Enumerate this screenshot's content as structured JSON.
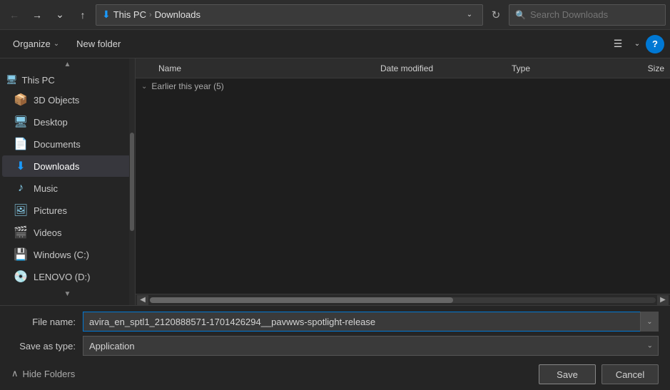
{
  "titlebar": {
    "back_label": "←",
    "forward_label": "→",
    "recent_label": "⌄",
    "up_label": "↑",
    "path_icon": "⬇",
    "breadcrumb": [
      "This PC",
      "Downloads"
    ],
    "breadcrumb_sep": "›",
    "dropdown_arrow": "⌄",
    "refresh_label": "↻",
    "search_placeholder": "Search Downloads"
  },
  "toolbar": {
    "organize_label": "Organize",
    "new_folder_label": "New folder",
    "view_icon": "☰",
    "view_dropdown": "⌄",
    "help_label": "?"
  },
  "sidebar": {
    "scroll_up": "▲",
    "scroll_down": "▼",
    "this_pc_label": "This PC",
    "items": [
      {
        "id": "3d-objects",
        "label": "3D Objects",
        "icon": "📦"
      },
      {
        "id": "desktop",
        "label": "Desktop",
        "icon": "🖥"
      },
      {
        "id": "documents",
        "label": "Documents",
        "icon": "📄"
      },
      {
        "id": "downloads",
        "label": "Downloads",
        "icon": "⬇",
        "active": true
      },
      {
        "id": "music",
        "label": "Music",
        "icon": "♪"
      },
      {
        "id": "pictures",
        "label": "Pictures",
        "icon": "🖼"
      },
      {
        "id": "videos",
        "label": "Videos",
        "icon": "🎬"
      },
      {
        "id": "windows-c",
        "label": "Windows (C:)",
        "icon": "💾"
      },
      {
        "id": "lenovo-d",
        "label": "LENOVO (D:)",
        "icon": "💿"
      }
    ]
  },
  "file_list": {
    "columns": {
      "name": "Name",
      "date_modified": "Date modified",
      "type": "Type",
      "size": "Size"
    },
    "groups": [
      {
        "label": "Earlier this year (5)",
        "chevron": "⌄",
        "files": []
      }
    ]
  },
  "bottom": {
    "file_name_label": "File name:",
    "file_name_value": "avira_en_sptl1_2120888571-1701426294__pavwws-spotlight-release",
    "save_as_type_label": "Save as type:",
    "save_as_type_value": "Application",
    "save_label": "Save",
    "cancel_label": "Cancel",
    "hide_folders_label": "Hide Folders",
    "hide_icon": "∧"
  }
}
